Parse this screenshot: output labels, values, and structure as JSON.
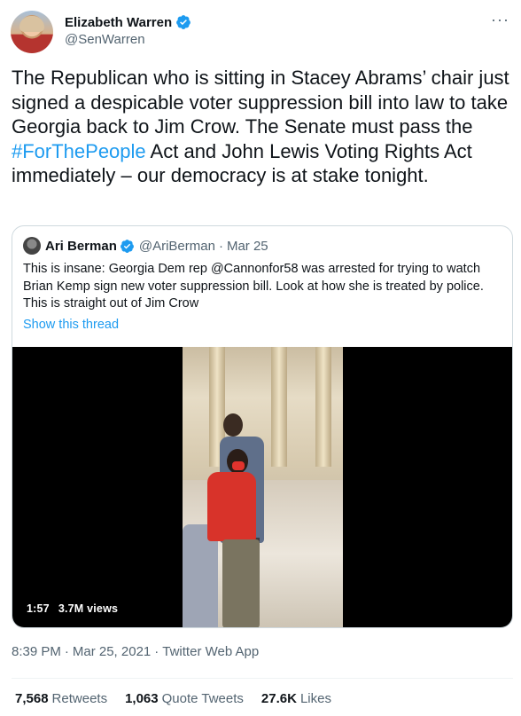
{
  "author": {
    "display_name": "Elizabeth Warren",
    "handle": "@SenWarren",
    "verified_icon": "verified-badge-icon"
  },
  "more_icon": "···",
  "tweet": {
    "text_before": "The Republican who is sitting in Stacey Abrams’ chair just signed a despicable voter suppression bill into law to take Georgia back to Jim Crow. The Senate must pass the ",
    "hashtag": "#ForThePeople",
    "text_after": " Act and John Lewis Voting Rights Act immediately – our democracy is at stake tonight."
  },
  "quote": {
    "display_name": "Ari Berman",
    "handle": "@AriBerman",
    "separator": "·",
    "date": "Mar 25",
    "text": "This is insane: Georgia Dem rep @Cannonfor58 was arrested for trying to watch Brian Kemp sign new voter suppression bill. Look at how she is treated by police. This is straight out of Jim Crow",
    "show_thread": "Show this thread",
    "video": {
      "duration": "1:57",
      "views": "3.7M views"
    }
  },
  "meta": {
    "time": "8:39 PM",
    "dot": "·",
    "date": "Mar 25, 2021",
    "source": "Twitter Web App"
  },
  "stats": {
    "retweets_count": "7,568",
    "retweets_label": "Retweets",
    "quotes_count": "1,063",
    "quotes_label": "Quote Tweets",
    "likes_count": "27.6K",
    "likes_label": "Likes"
  },
  "colors": {
    "accent": "#1d9bf0",
    "secondary_text": "#536471",
    "border": "#cfd9de"
  }
}
